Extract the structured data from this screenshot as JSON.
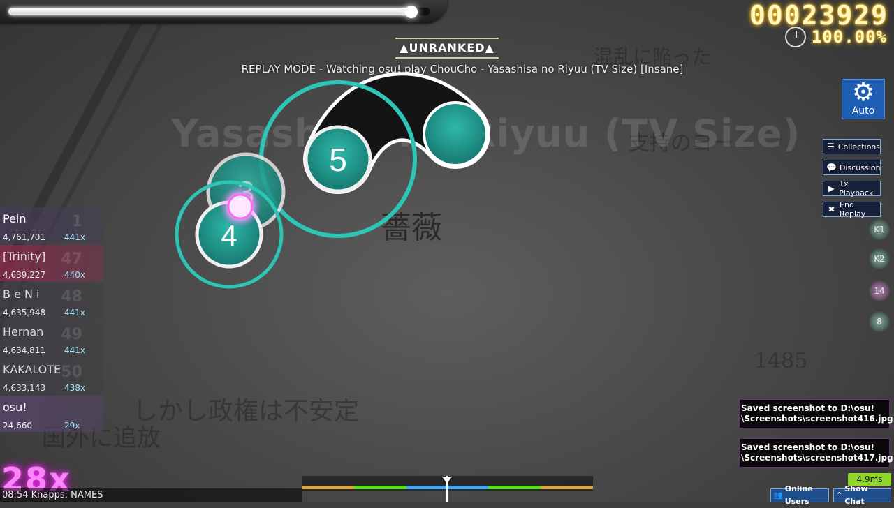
{
  "hud": {
    "health_fraction": 0.96,
    "score": "00023929",
    "accuracy": "100.00%",
    "status": "▲UNRANKED▲",
    "replay_title": "REPLAY MODE - Watching osu! play ChouCho - Yasashisa no Riyuu (TV Size) [Insane]",
    "background_title": "Yasashisa no Riyuu (TV Size)"
  },
  "auto_button": {
    "icon": "gear-icon",
    "label": "Auto"
  },
  "side_buttons": [
    {
      "icon": "list-icon",
      "label": "Collections"
    },
    {
      "icon": "chat-bubble-icon",
      "label": "Discussion"
    },
    {
      "icon": "play-icon",
      "label": "1x Playback"
    },
    {
      "icon": "close-icon",
      "label": "End Replay"
    }
  ],
  "key_overlay": [
    {
      "label": "K1"
    },
    {
      "label": "K2"
    },
    {
      "label": "14"
    },
    {
      "label": "8"
    }
  ],
  "leaderboard": [
    {
      "rank": "1",
      "name": "Pein",
      "score": "4,761,701",
      "combo": "441x"
    },
    {
      "rank": "47",
      "name": "[Trinity]",
      "score": "4,639,227",
      "combo": "440x"
    },
    {
      "rank": "48",
      "name": "B e N i",
      "score": "4,635,948",
      "combo": "441x"
    },
    {
      "rank": "49",
      "name": "Hernan",
      "score": "4,634,811",
      "combo": "441x"
    },
    {
      "rank": "50",
      "name": "KAKALOTE",
      "score": "4,633,143",
      "combo": "438x"
    },
    {
      "rank": "",
      "name": "osu!",
      "score": "24,660",
      "combo": "29x"
    }
  ],
  "playfield": {
    "circles": [
      {
        "number": "3"
      },
      {
        "number": "4"
      },
      {
        "number": "5"
      }
    ],
    "accent_color": "#1fa79a",
    "approach_color": "#2ec4b6"
  },
  "combo_counter": "28x",
  "chat_line": "08:54 Knapps: NAMES",
  "notifications": [
    {
      "text": "Saved screenshot to D:\\osu!\n\\Screenshots\\screenshot416.jpg"
    },
    {
      "text": "Saved screenshot to D:\\osu!\n\\Screenshots\\screenshot417.jpg"
    }
  ],
  "frametime": "4.9ms",
  "bottom_buttons": [
    {
      "icon": "users-icon",
      "label": "Online Users"
    },
    {
      "icon": "chevron-up-icon",
      "label": "Show Chat"
    }
  ],
  "colors": {
    "score_glow": "#ffb800",
    "auto_bg": "#1f5fb3",
    "hit_300": "#3fa9f5",
    "hit_100": "#57e31c",
    "hit_50": "#d9a441"
  }
}
